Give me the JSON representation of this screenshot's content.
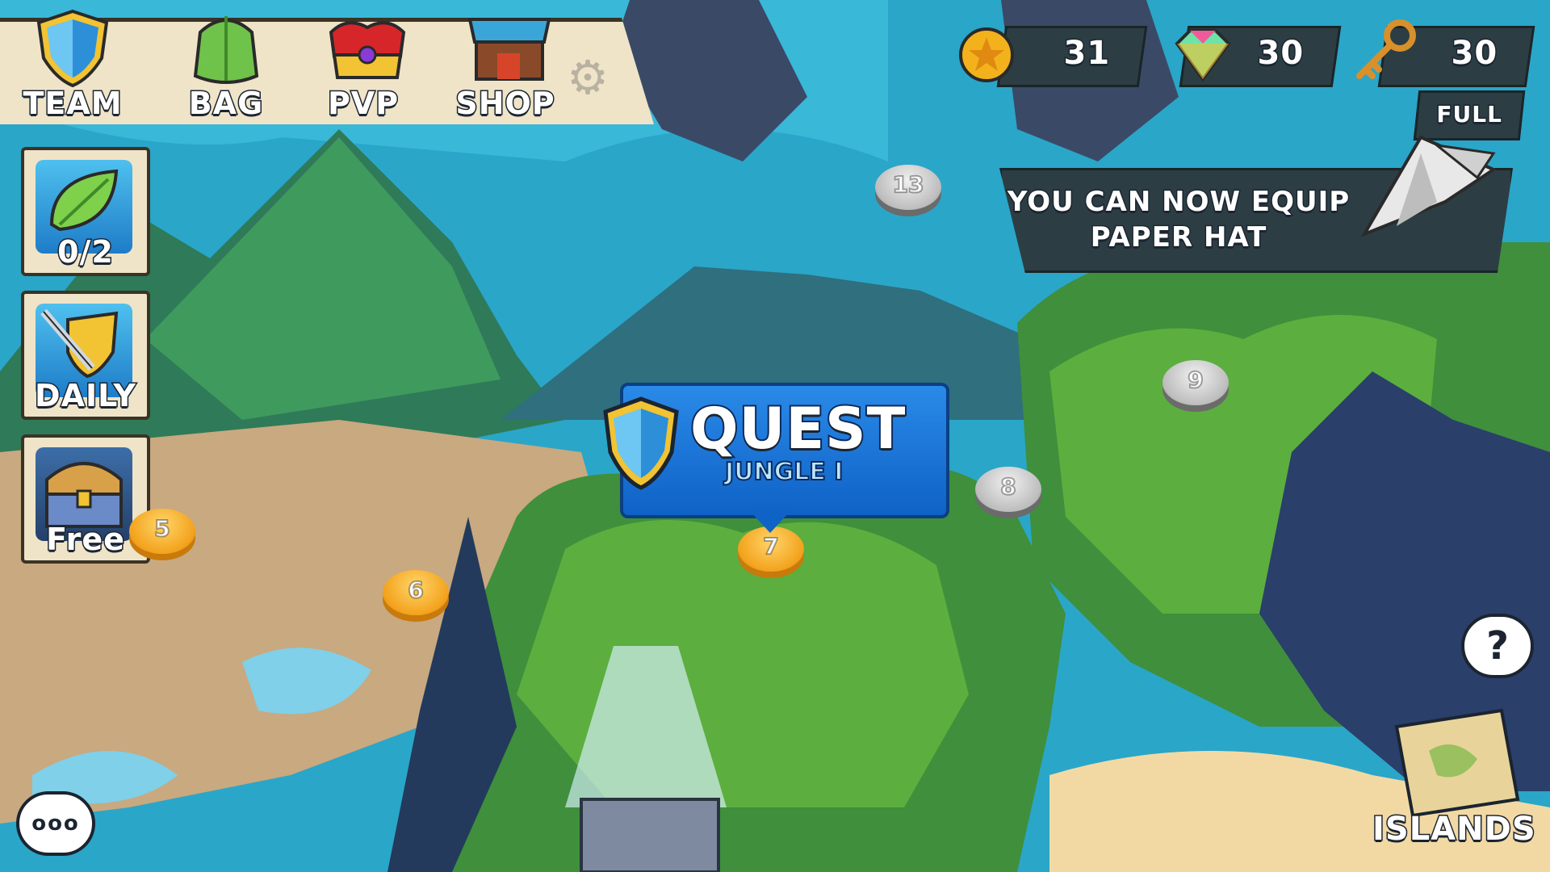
{
  "menu": {
    "team_label": "TEAM",
    "bag_label": "BAG",
    "pvp_label": "PVP",
    "shop_label": "SHOP"
  },
  "side": {
    "leaf_count": "0/2",
    "daily_label": "DAILY",
    "free_label": "Free"
  },
  "currency": {
    "coins": "31",
    "gems": "30",
    "keys": "30",
    "keys_status": "FULL"
  },
  "notification": {
    "line1": "YOU CAN NOW EQUIP",
    "line2": "PAPER HAT"
  },
  "quest": {
    "title": "QUEST",
    "subtitle": "JUNGLE I"
  },
  "levels": [
    {
      "number": "5",
      "state": "unlocked"
    },
    {
      "number": "6",
      "state": "unlocked"
    },
    {
      "number": "7",
      "state": "current"
    },
    {
      "number": "8",
      "state": "locked"
    },
    {
      "number": "9",
      "state": "locked"
    },
    {
      "number": "13",
      "state": "locked"
    }
  ],
  "help_label": "?",
  "chat_label": "ooo",
  "islands_label": "ISLANDS",
  "colors": {
    "menu_bg": "#efe4c8",
    "hud_bg": "#2c3e44",
    "quest_blue": "#1572d8",
    "level_gold": "#f3a21c",
    "level_grey": "#bdbdbd"
  }
}
